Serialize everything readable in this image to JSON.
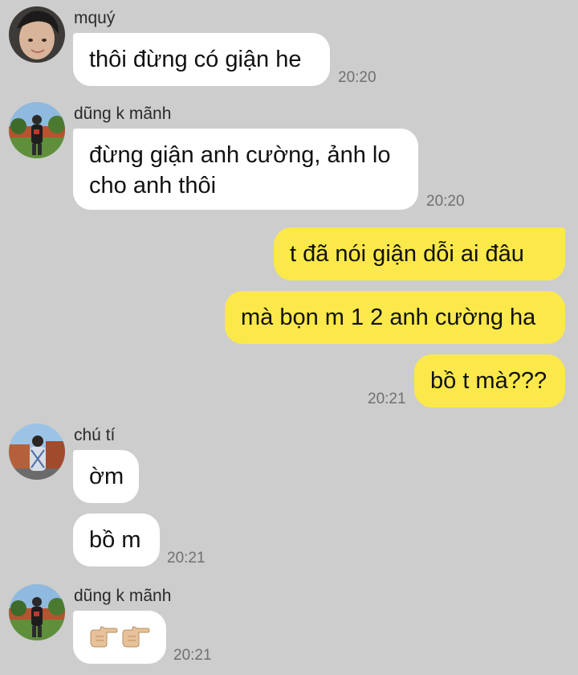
{
  "messages": [
    {
      "sender": "mquý",
      "avatar": "avatar-mquy",
      "text": "thôi đừng có giận he",
      "time": "20:20"
    },
    {
      "sender": "dũng k mãnh",
      "avatar": "avatar-dung",
      "text_lines": [
        "đừng giận anh cường, ảnh lo",
        "cho anh thôi"
      ],
      "time": "20:20"
    },
    {
      "sender": "me",
      "text": "t đã nói giận dỗi ai đâu"
    },
    {
      "sender": "me",
      "text": "mà bọn m 1 2 anh cường ha"
    },
    {
      "sender": "me",
      "text": "bồ t mà???",
      "time": "20:21"
    },
    {
      "sender": "chú tí",
      "avatar": "avatar-chu-ti",
      "text": "ờm"
    },
    {
      "sender": "chú tí",
      "text": "bồ m",
      "time": "20:21"
    },
    {
      "sender": "dũng k mãnh",
      "avatar": "avatar-dung",
      "emoji": [
        "pointing-right-hand",
        "pointing-right-hand"
      ],
      "time": "20:21"
    }
  ],
  "colors": {
    "background": "#cdcdcd",
    "incoming_bubble": "#ffffff",
    "outgoing_bubble": "#fbe84a",
    "time_text": "#707070"
  }
}
